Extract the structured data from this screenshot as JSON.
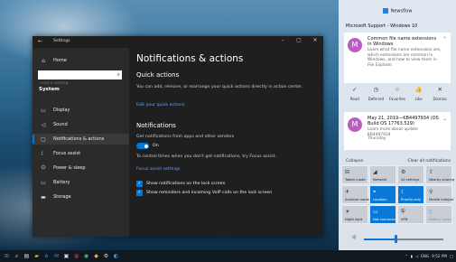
{
  "settings": {
    "window_title": "Settings",
    "controls": [
      "–",
      "▢",
      "✕"
    ],
    "sidebar": {
      "home": "Home",
      "search_placeholder": "Find a setting",
      "section": "System",
      "items": [
        {
          "label": "Display",
          "icon": "monitor-icon"
        },
        {
          "label": "Sound",
          "icon": "speaker-icon"
        },
        {
          "label": "Notifications & actions",
          "icon": "notifications-icon"
        },
        {
          "label": "Focus assist",
          "icon": "moon-icon"
        },
        {
          "label": "Power & sleep",
          "icon": "power-icon"
        },
        {
          "label": "Battery",
          "icon": "battery-icon"
        },
        {
          "label": "Storage",
          "icon": "storage-icon"
        }
      ]
    },
    "main": {
      "title": "Notifications & actions",
      "quick_actions_heading": "Quick actions",
      "quick_actions_desc": "You can add, remove, or rearrange your quick actions directly in action center.",
      "edit_link": "Edit your quick actions",
      "notifications_heading": "Notifications",
      "notifications_desc": "Get notifications from apps and other senders",
      "toggle_state": "On",
      "focus_text": "To control times when you don't get notifications, try Focus assist.",
      "focus_link": "Focus assist settings",
      "checkbox1": "Show notifications on the lock screen",
      "checkbox2": "Show reminders and incoming VoIP calls on the lock screen"
    }
  },
  "action_center": {
    "header": "Newsflow",
    "source": "Microsoft Support - Windows 10",
    "card1": {
      "avatar": "M",
      "title": "Common file name extensions in Windows",
      "body": "Learn what file name extensions are, which extensions are common in Windows, and how to view them in File Explorer."
    },
    "actions": [
      {
        "label": "Read",
        "icon": "✓"
      },
      {
        "label": "Deferred",
        "icon": "◷"
      },
      {
        "label": "Favorites",
        "icon": "☆"
      },
      {
        "label": "Like",
        "icon": "👍"
      },
      {
        "label": "Dismiss",
        "icon": "✕"
      }
    ],
    "card2": {
      "avatar": "M",
      "title": "May 21, 2019—KB4497934 (OS Build OS 17763.529)",
      "body": "Learn more about update KB4497934",
      "meta": "Thursday"
    },
    "collapse": "Collapse",
    "clear_all": "Clear all notifications",
    "tiles": [
      {
        "label": "Tablet mode",
        "icon": "⊟",
        "on": false,
        "dim": false
      },
      {
        "label": "Network",
        "icon": "◢",
        "on": false,
        "dim": false
      },
      {
        "label": "All settings",
        "icon": "⚙",
        "on": false,
        "dim": false
      },
      {
        "label": "Nearby sharing",
        "icon": "⇪",
        "on": false,
        "dim": false
      },
      {
        "label": "Airplane mode",
        "icon": "✈",
        "on": false,
        "dim": false
      },
      {
        "label": "Location",
        "icon": "⌖",
        "on": true,
        "dim": false
      },
      {
        "label": "Priority only",
        "icon": "☾",
        "on": true,
        "dim": false
      },
      {
        "label": "Mobile hotspot",
        "icon": "⚲",
        "on": false,
        "dim": false
      },
      {
        "label": "Night light",
        "icon": "☀",
        "on": false,
        "dim": false
      },
      {
        "label": "Not connected",
        "icon": "▭",
        "on": true,
        "dim": false
      },
      {
        "label": "VPN",
        "icon": "⛨",
        "on": false,
        "dim": false
      },
      {
        "label": "Battery saver",
        "icon": "▯",
        "on": false,
        "dim": true
      }
    ],
    "brightness": {
      "level": 0.4,
      "icon": "☼"
    }
  },
  "taskbar": {
    "tray_lang": "ENG",
    "tray_time": "9:52 PM"
  }
}
